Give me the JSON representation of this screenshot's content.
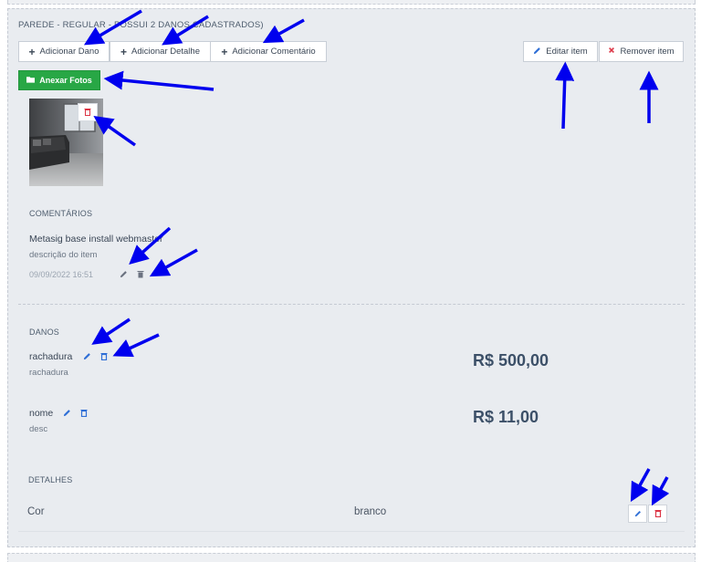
{
  "panel": {
    "title": "PAREDE - REGULAR - POSSUI 2 DANOS CADASTRADOS)"
  },
  "toolbar": {
    "add_damage": "Adicionar Dano",
    "add_detail": "Adicionar Detalhe",
    "add_comment": "Adicionar Comentário",
    "edit_item": "Editar item",
    "remove_item": "Remover item",
    "attach_photos": "Anexar Fotos"
  },
  "comments": {
    "heading": "COMENTÁRIOS",
    "items": [
      {
        "title": "Metasig base install webmaster",
        "description": "descrição do item",
        "date": "09/09/2022 16:51"
      }
    ]
  },
  "damages": {
    "heading": "DANOS",
    "items": [
      {
        "name": "rachadura",
        "description": "rachadura",
        "value": "R$ 500,00"
      },
      {
        "name": "nome",
        "description": "desc",
        "value": "R$ 11,00"
      }
    ]
  },
  "details": {
    "heading": "DETALHES",
    "items": [
      {
        "key": "Cor",
        "value": "branco"
      }
    ]
  },
  "colors": {
    "accent_green": "#28a745",
    "edit_blue": "#2f6fd6",
    "delete_red": "#dc3545",
    "annotation_arrow": "#0000ee"
  },
  "icons": [
    "plus-icon",
    "pencil-icon",
    "x-icon",
    "folder-icon",
    "trash-icon"
  ]
}
